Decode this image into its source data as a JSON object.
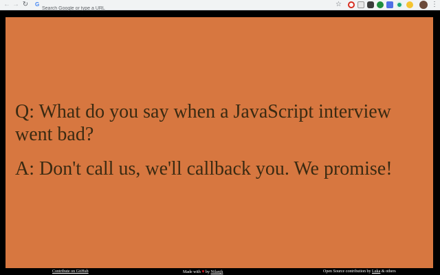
{
  "browser": {
    "omnibox_placeholder": "Search Google or type a URL",
    "google_logo": "G",
    "nav": {
      "back_icon": "←",
      "forward_icon": "→",
      "reload_icon": "↻"
    },
    "star_icon": "☆",
    "menu_icon": "⋮",
    "extensions": [
      "opera-extension-icon",
      "clipboard-extension-icon",
      "cat-extension-icon",
      "green-pin-extension-icon",
      "blue-square-extension-icon",
      "grammarly-extension-icon",
      "emoji-extension-icon"
    ]
  },
  "joke": {
    "question": "Q: What do you say when a JavaScript interview went bad?",
    "answer": "A: Don't call us, we'll callback you. We promise!"
  },
  "footer": {
    "contribute_link": "Contribute on GitHub",
    "made_with_prefix": "Made with",
    "heart": "♥",
    "made_with_by": "by",
    "author_link": "Nilanjk",
    "open_source_prefix": "Open Source contribution by",
    "contributor_link": "Luka",
    "open_source_suffix": "& others"
  },
  "colors": {
    "card_background": "#d77740",
    "text": "#3a2a12",
    "page_background": "#000000",
    "heart": "#e01b24"
  }
}
